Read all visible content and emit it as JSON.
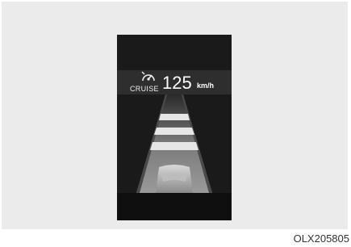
{
  "cluster": {
    "mode_label": "CRUISE",
    "icon": "cruise-control-icon",
    "set_speed": "125",
    "speed_unit": "km/h",
    "colors": {
      "display_bg": "#1a1a1a",
      "header_bg": "#2e2e2e",
      "text": "#ffffff",
      "lane_bar": "#e6e6e6"
    }
  },
  "image_code": "OLX205805"
}
